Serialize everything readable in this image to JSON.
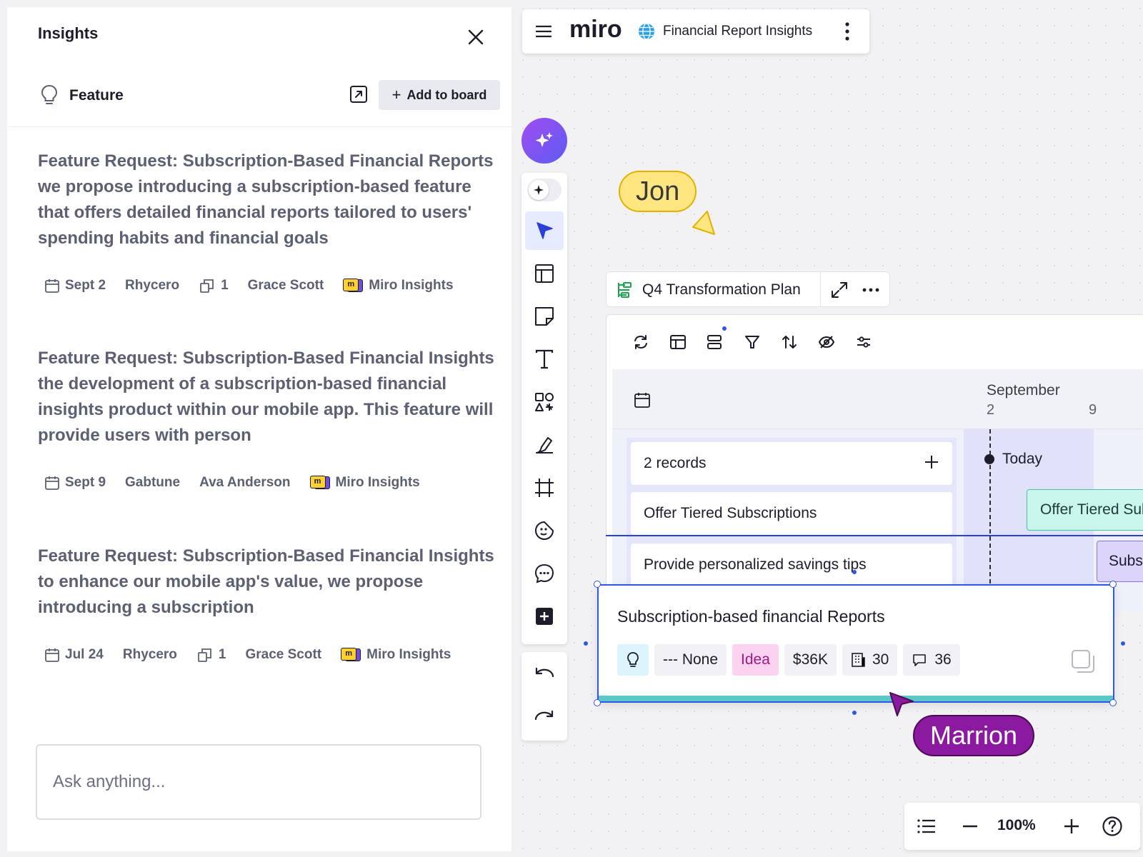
{
  "panel": {
    "title": "Insights",
    "subtitle": "Feature",
    "add_label": "Add to board",
    "ask_placeholder": "Ask anything..."
  },
  "insights": [
    {
      "text": "Feature Request: Subscription-Based Financial Reports we propose introducing a subscription-based feature that offers detailed financial reports tailored to users' spending habits and financial goals",
      "date": "Sept 2",
      "company": "Rhycero",
      "count": "1",
      "author": "Grace Scott",
      "source": "Miro Insights"
    },
    {
      "text": "Feature Request: Subscription-Based Financial Insights the development of a subscription-based financial insights product within our mobile app. This feature will provide users with person",
      "date": "Sept 9",
      "company": "Gabtune",
      "count": "",
      "author": "Ava Anderson",
      "source": "Miro Insights"
    },
    {
      "text": "Feature Request: Subscription-Based Financial Insights to enhance our mobile app's value, we propose introducing a subscription",
      "date": "Jul 24",
      "company": "Rhycero",
      "count": "1",
      "author": "Grace Scott",
      "source": "Miro Insights"
    }
  ],
  "topbar": {
    "logo": "miro",
    "board_name": "Financial Report Insights"
  },
  "cursors": {
    "jon": "Jon",
    "marrion": "Marrion"
  },
  "frame": {
    "title": "Q4 Transformation Plan"
  },
  "timeline": {
    "month": "September",
    "days": [
      "2",
      "9"
    ],
    "records_label": "2 records",
    "today_label": "Today",
    "rows": [
      "Offer Tiered Subscriptions",
      "Provide personalized savings tips"
    ],
    "bars": [
      "Offer Tiered Subscriptions",
      "Subscription"
    ]
  },
  "card": {
    "title": "Subscription-based financial Reports",
    "priority": "--- None",
    "status": "Idea",
    "value": "$36K",
    "companies": "30",
    "comments": "36"
  },
  "zoom": {
    "level": "100%"
  },
  "colors": {
    "accent": "#3056e6",
    "idea_chip": "#fbd3f1",
    "jon_cursor": "#ffe680",
    "marrion_cursor": "#8c1aa0",
    "ai_gradient_start": "#a24cf0",
    "ai_gradient_end": "#5c5cf2"
  }
}
